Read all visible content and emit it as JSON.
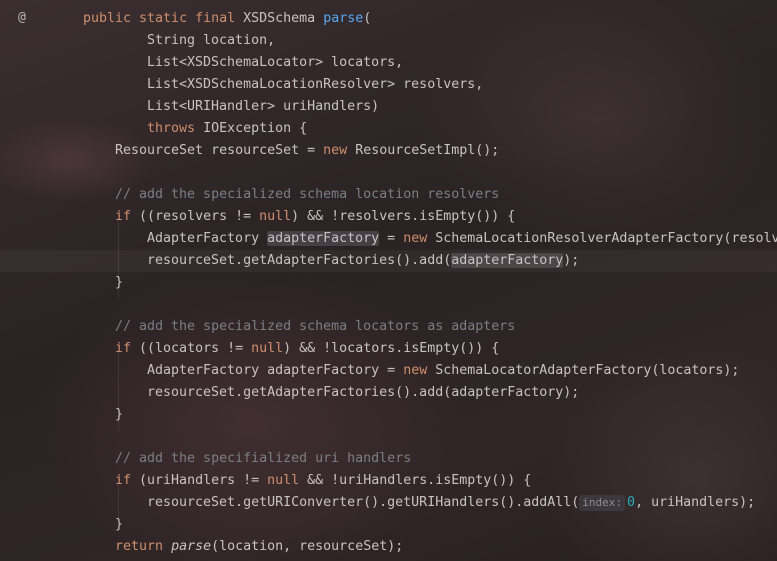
{
  "gutter": {
    "override_marker": "@"
  },
  "code": {
    "l1": {
      "mods": "public static final",
      "type": "XSDSchema",
      "method": "parse",
      "open": "("
    },
    "l2": "String location,",
    "l3": "List<XSDSchemaLocator> locators,",
    "l4": "List<XSDSchemaLocationResolver> resolvers,",
    "l5": "List<URIHandler> uriHandlers)",
    "l6": {
      "kw": "throws",
      "rest": "IOException {"
    },
    "l7": {
      "a": "ResourceSet resourceSet = ",
      "kw": "new",
      "b": "ResourceSetImpl();"
    },
    "l9": "// add the specialized schema location resolvers",
    "l10": {
      "kw": "if",
      "a": "((resolvers != ",
      "kw2": "null",
      "b": ") && !resolvers.isEmpty()) {"
    },
    "l11": {
      "a": "AdapterFactory ",
      "var": "adapterFactory",
      "b": " = ",
      "kw": "new",
      "c": " SchemaLocationResolverAdapterFactory(resolve"
    },
    "l12": {
      "a": "resourceSet.getAdapterFactories().add(",
      "var": "adapterFactory",
      "b": ");"
    },
    "l13": "}",
    "l15": "// add the specialized schema locators as adapters",
    "l16": {
      "kw": "if",
      "a": "((locators != ",
      "kw2": "null",
      "b": ") && !locators.isEmpty()) {"
    },
    "l17": {
      "a": "AdapterFactory adapterFactory = ",
      "kw": "new",
      "b": " SchemaLocatorAdapterFactory(locators);"
    },
    "l18": "resourceSet.getAdapterFactories().add(adapterFactory);",
    "l19": "}",
    "l21": "// add the specifialized uri handlers",
    "l22": {
      "kw": "if",
      "a": "(uriHandlers != ",
      "kw2": "null",
      "b": " && !uriHandlers.isEmpty()) {"
    },
    "l23": {
      "a": "resourceSet.getURIConverter().getURIHandlers().addAll(",
      "hint": "index:",
      "num": "0",
      "b": ", uriHandlers);"
    },
    "l24": "}",
    "l25": {
      "kw": "return",
      "method": "parse",
      "b": "(location, resourceSet);"
    }
  },
  "colors": {
    "keyword": "#cf8e6d",
    "method_decl": "#56a8f5",
    "comment": "#7a7e85",
    "number": "#2aacb8",
    "text": "#c9c2c2"
  }
}
